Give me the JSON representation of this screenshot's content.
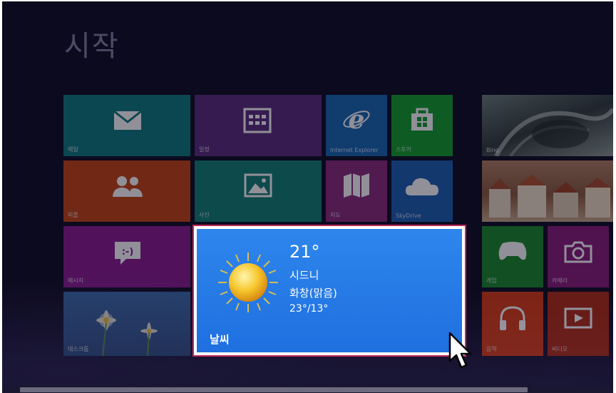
{
  "start": {
    "title": "시작"
  },
  "tiles": {
    "mail": {
      "label": "메일",
      "icon": "mail-icon",
      "color": "#0b6b6c"
    },
    "calendar": {
      "label": "일정",
      "icon": "calendar-icon",
      "color": "#4a1f63"
    },
    "ie": {
      "label": "Internet Explorer",
      "icon": "internet-explorer-icon",
      "color": "#114a84"
    },
    "store": {
      "label": "스토어",
      "icon": "store-icon",
      "color": "#0c6b1e"
    },
    "bing": {
      "label": "Bing",
      "icon": "bing-photo-icon",
      "color": "#3d4c48"
    },
    "people": {
      "label": "피플",
      "icon": "people-icon",
      "color": "#8a2e0e"
    },
    "photos": {
      "label": "사진",
      "icon": "photos-icon",
      "color": "#0d5850"
    },
    "maps": {
      "label": "지도",
      "icon": "maps-icon",
      "color": "#5d1e55"
    },
    "skydrive": {
      "label": "SkyDrive",
      "icon": "skydrive-icon",
      "color": "#12417a"
    },
    "travel": {
      "label": "",
      "icon": "travel-photo-icon",
      "color": "#5a3e2e"
    },
    "messaging": {
      "label": "메시지",
      "icon": "messaging-icon",
      "color": "#5a0e5c"
    },
    "games": {
      "label": "게임",
      "icon": "games-icon",
      "color": "#0f5a1a"
    },
    "camera": {
      "label": "카메라",
      "icon": "camera-icon",
      "color": "#5a0e4c"
    },
    "desktop": {
      "label": "데스크톱",
      "icon": "desktop-photo-icon",
      "color": "#1d3350"
    },
    "music": {
      "label": "음악",
      "icon": "headphones-icon",
      "color": "#8a2410"
    },
    "video": {
      "label": "비디오",
      "icon": "video-icon",
      "color": "#7a1808"
    }
  },
  "weather": {
    "temperature": "21°",
    "city": "시드니",
    "condition": "화창(맑음)",
    "range": "23°/13°",
    "label": "날씨",
    "icon": "sun-icon",
    "color": "#2a7ee8"
  }
}
